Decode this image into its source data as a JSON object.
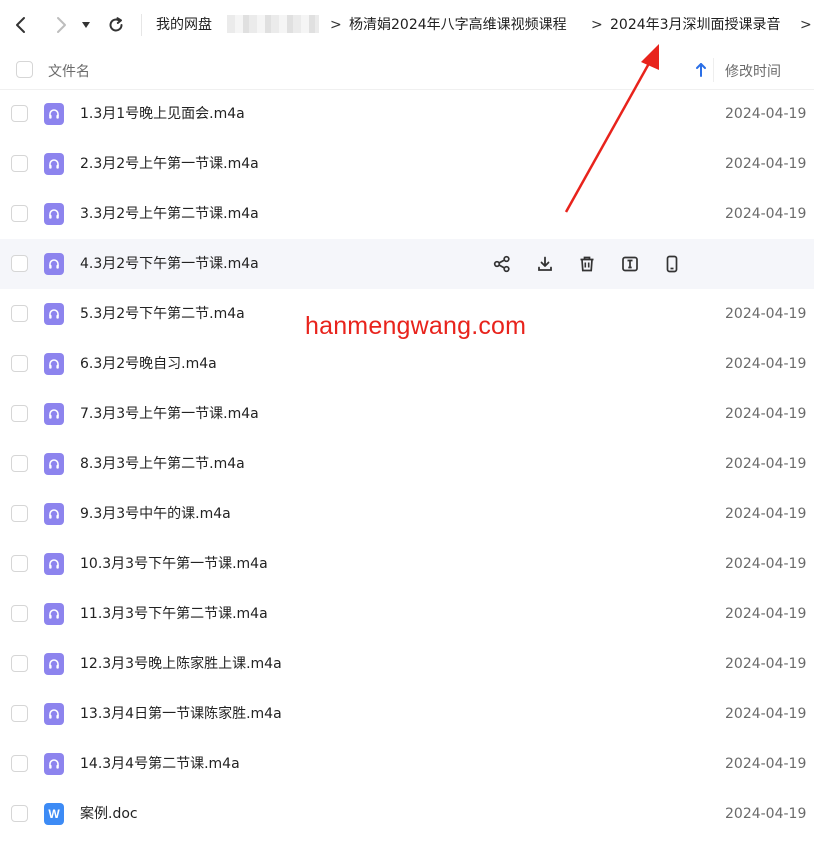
{
  "breadcrumb": {
    "root": "我的网盘",
    "sep": ">",
    "items": [
      "杨清娟2024年八字高维课视频课程",
      "2024年3月深圳面授课录音"
    ]
  },
  "header": {
    "name_label": "文件名",
    "time_label": "修改时间",
    "sort": "ascending"
  },
  "files": [
    {
      "name": "1.3月1号晚上见面会.m4a",
      "time": "2024-04-19",
      "type": "audio-icon"
    },
    {
      "name": "2.3月2号上午第一节课.m4a",
      "time": "2024-04-19",
      "type": "audio-icon"
    },
    {
      "name": "3.3月2号上午第二节课.m4a",
      "time": "2024-04-19",
      "type": "audio-icon"
    },
    {
      "name": "4.3月2号下午第一节课.m4a",
      "time": "",
      "type": "audio-icon",
      "hovered": true
    },
    {
      "name": "5.3月2号下午第二节.m4a",
      "time": "2024-04-19",
      "type": "audio-icon"
    },
    {
      "name": "6.3月2号晚自习.m4a",
      "time": "2024-04-19",
      "type": "audio-icon"
    },
    {
      "name": "7.3月3号上午第一节课.m4a",
      "time": "2024-04-19",
      "type": "audio-icon"
    },
    {
      "name": "8.3月3号上午第二节.m4a",
      "time": "2024-04-19",
      "type": "audio-icon"
    },
    {
      "name": "9.3月3号中午的课.m4a",
      "time": "2024-04-19",
      "type": "audio-icon"
    },
    {
      "name": "10.3月3号下午第一节课.m4a",
      "time": "2024-04-19",
      "type": "audio-icon"
    },
    {
      "name": "11.3月3号下午第二节课.m4a",
      "time": "2024-04-19",
      "type": "audio-icon"
    },
    {
      "name": "12.3月3号晚上陈家胜上课.m4a",
      "time": "2024-04-19",
      "type": "audio-icon"
    },
    {
      "name": "13.3月4日第一节课陈家胜.m4a",
      "time": "2024-04-19",
      "type": "audio-icon"
    },
    {
      "name": "14.3月4号第二节课.m4a",
      "time": "2024-04-19",
      "type": "audio-icon"
    },
    {
      "name": "案例.doc",
      "time": "2024-04-19",
      "type": "word-doc-icon"
    }
  ],
  "row_actions": [
    "share-icon",
    "download-icon",
    "delete-icon",
    "rename-icon",
    "send-to-phone-icon"
  ],
  "doc_icon_letter": "W",
  "watermark": "hanmengwang.com",
  "colors": {
    "audio_icon": "#8d84ee",
    "doc_icon": "#3d8bf5",
    "sort_arrow": "#2b6fe6",
    "annotation": "#e8231c",
    "hover_row": "#f5f6fa"
  }
}
